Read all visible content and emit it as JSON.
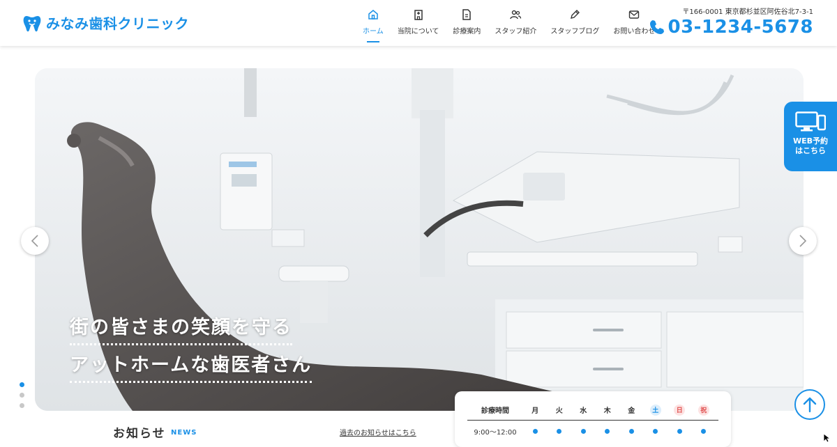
{
  "header": {
    "logo_text": "みなみ歯科クリニック",
    "address": "〒166-0001 東京都杉並区阿佐谷北7-3-1",
    "phone": "03-1234-5678"
  },
  "nav": {
    "items": [
      {
        "label": "ホーム",
        "icon": "home-icon"
      },
      {
        "label": "当院について",
        "icon": "building-icon"
      },
      {
        "label": "診療案内",
        "icon": "document-icon"
      },
      {
        "label": "スタッフ紹介",
        "icon": "people-icon"
      },
      {
        "label": "スタッフブログ",
        "icon": "pencil-icon"
      },
      {
        "label": "お問い合わせ",
        "icon": "mail-icon"
      }
    ],
    "active": "ホーム"
  },
  "hero": {
    "catch_line1": "街の皆さまの笑顔を守る",
    "catch_line2": "アットホームな歯医者さん"
  },
  "web_reserve": {
    "label": "WEB予約\nはこちら"
  },
  "news": {
    "title": "お知らせ",
    "subtitle": "NEWS",
    "link": "過去のお知らせはこちら"
  },
  "hours": {
    "header_label": "診療時間",
    "days": [
      "月",
      "火",
      "水",
      "木",
      "金",
      "土",
      "日",
      "祝"
    ],
    "rows": [
      {
        "time": "9:00〜12:00",
        "open": [
          true,
          true,
          true,
          true,
          true,
          true,
          true,
          true
        ]
      }
    ]
  },
  "colors": {
    "accent": "#1a90e6",
    "holiday": "#e0504f"
  }
}
